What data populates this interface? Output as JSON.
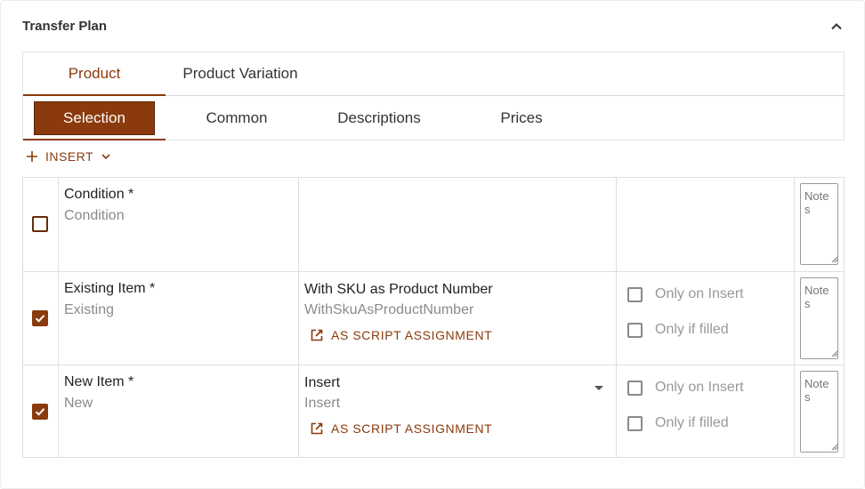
{
  "panel": {
    "title": "Transfer Plan"
  },
  "colors": {
    "accent": "#8a3a0c"
  },
  "icons": {
    "collapse": "chevron-up-icon",
    "insert": "plus-icon",
    "insert_menu": "chevron-down-icon",
    "script": "open-in-new-icon"
  },
  "tabs": [
    {
      "label": "Product",
      "active": true
    },
    {
      "label": "Product Variation",
      "active": false
    }
  ],
  "subtabs": [
    {
      "label": "Selection",
      "active": true
    },
    {
      "label": "Common",
      "active": false
    },
    {
      "label": "Descriptions",
      "active": false
    },
    {
      "label": "Prices",
      "active": false
    }
  ],
  "toolbar": {
    "insert_label": "INSERT"
  },
  "rows": [
    {
      "checked": false,
      "label": "Condition *",
      "sub": "Condition",
      "value": "",
      "value_sub": "",
      "notes_placeholder": "Notes"
    },
    {
      "checked": true,
      "label": "Existing Item *",
      "sub": "Existing",
      "value": "With SKU as Product Number",
      "value_sub": "WithSkuAsProductNumber",
      "script_label": "AS SCRIPT ASSIGNMENT",
      "opt1": "Only on Insert",
      "opt2": "Only if filled",
      "notes_placeholder": "Notes"
    },
    {
      "checked": true,
      "label": "New Item *",
      "sub": "New",
      "value": "Insert",
      "value_sub": "Insert",
      "script_label": "AS SCRIPT ASSIGNMENT",
      "opt1": "Only on Insert",
      "opt2": "Only if filled",
      "notes_placeholder": "Notes"
    }
  ]
}
